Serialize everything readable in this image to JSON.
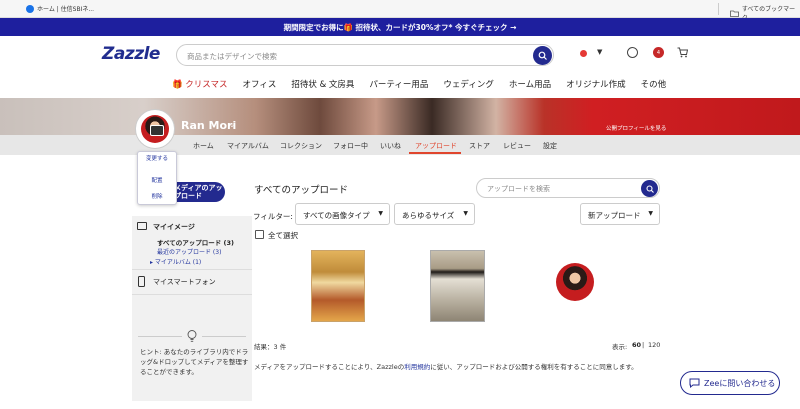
{
  "browser": {
    "tab_title": "ホーム | 住信SBIネ...",
    "bookmarks_label": "すべてのブックマーク"
  },
  "promo": {
    "text": "期間限定でお得に🎁 招待状、カードが30%オフ* 今すぐチェック →"
  },
  "header": {
    "logo": "Zazzle",
    "search_placeholder": "商品またはデザインで検索",
    "badge_count": "4"
  },
  "nav": {
    "items": [
      "🎁 クリスマス",
      "オフィス",
      "招待状 & 文房具",
      "パーティー用品",
      "ウェディング",
      "ホーム用品",
      "オリジナル作成",
      "その他"
    ]
  },
  "profile": {
    "name": "Ran Mori",
    "public_profile": "公開プロフィールを見る",
    "avatar_menu": [
      "変更する",
      "配置",
      "削除"
    ]
  },
  "tabs": {
    "items": [
      "ホーム",
      "マイアルバム",
      "コレクション",
      "フォロー中",
      "いいね",
      "アップロード",
      "ストア",
      "レビュー",
      "設定"
    ],
    "active": "アップロード"
  },
  "sidebar": {
    "upload_button": "メディアのアップロード",
    "my_image": "マイイメージ",
    "all_uploads": "すべてのアップロード (3)",
    "recent_uploads": "最近のアップロード (3)",
    "my_album": "マイアルバム (1)",
    "my_smartphone": "マイスマートフォン",
    "hint": "ヒント: あなたのライブラリ内でドラッグ&ドロップしてメディアを整理することができます。"
  },
  "main": {
    "title": "すべてのアップロード",
    "search_placeholder": "アップロードを検索",
    "filter_label": "フィルター:",
    "filter_type": "すべての画像タイプ",
    "filter_size": "あらゆるサイズ",
    "sort": "新アップロード",
    "select_all": "全て選択",
    "results": "結果：3 件",
    "display_label": "表示:",
    "display_60": "60",
    "display_sep": "|",
    "display_120": "120",
    "terms_before": "メディアをアップロードすることにより、Zazzleの",
    "terms_link": "利用規約",
    "terms_after": "に従い、アップロードおよび公開する権利を有することに同意します。"
  },
  "help": {
    "zee": "Zeeに問い合わせる"
  }
}
